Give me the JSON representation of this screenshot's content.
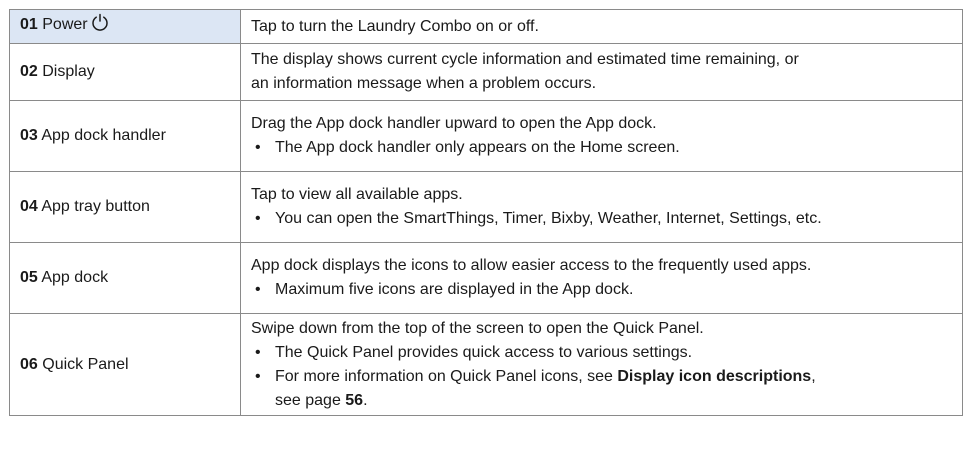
{
  "rows": [
    {
      "num": "01",
      "name": "Power",
      "icon": "power-icon",
      "desc": "Tap to turn the Laundry Combo on or off."
    },
    {
      "num": "02",
      "name": "Display",
      "desc_line1": "The display shows current cycle information and estimated time remaining, or",
      "desc_line2": "an information message when a problem occurs."
    },
    {
      "num": "03",
      "name": "App dock handler",
      "desc": "Drag the App dock handler upward to open the App dock.",
      "bullets": [
        "The App dock handler only appears on the Home screen."
      ]
    },
    {
      "num": "04",
      "name": "App tray button",
      "desc": "Tap to view all available apps.",
      "bullets": [
        "You can open the SmartThings, Timer, Bixby, Weather, Internet, Settings, etc."
      ]
    },
    {
      "num": "05",
      "name": "App dock",
      "desc": "App dock displays the icons to allow easier access to the frequently used apps.",
      "bullets": [
        "Maximum five icons are displayed in the App dock."
      ]
    },
    {
      "num": "06",
      "name": "Quick Panel",
      "desc": "Swipe down from the top of the screen to open the Quick Panel.",
      "bullet1": "The Quick Panel provides quick access to various settings.",
      "bullet2_prefix": "For more information on Quick Panel icons, see ",
      "bullet2_link": "Display icon descriptions",
      "bullet2_mid": ",",
      "bullet2_line2_prefix": "see page ",
      "bullet2_page": "56",
      "bullet2_suffix": "."
    }
  ],
  "bullet_glyph": "•"
}
